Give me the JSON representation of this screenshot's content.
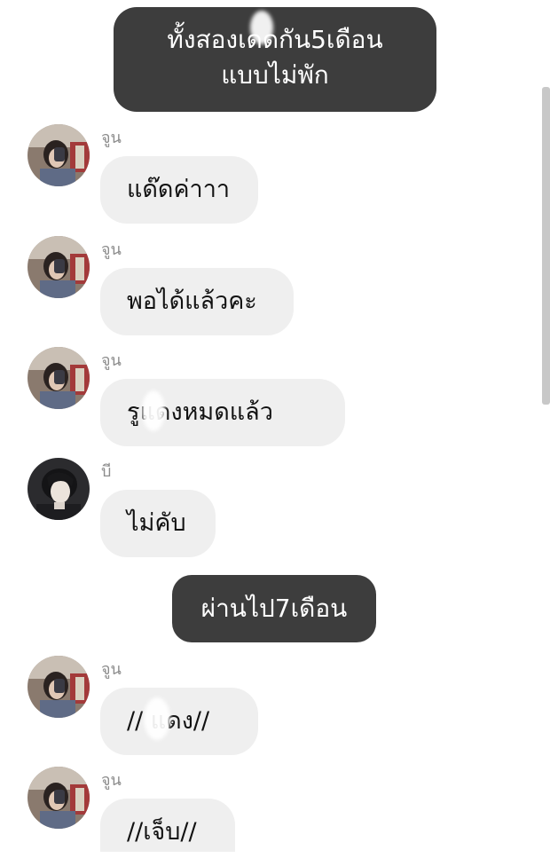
{
  "narrations": [
    {
      "lines": [
        "ทั้งสองเดดกัน5เดือน",
        "แบบไม่พัก"
      ]
    },
    {
      "lines": [
        "ผ่านไป7เดือน"
      ]
    }
  ],
  "messages": [
    {
      "sender": "จูน",
      "text": "แด๊ดค่าาา",
      "avatar": "selfie-photo"
    },
    {
      "sender": "จูน",
      "text": "พอได้แล้วคะ",
      "avatar": "selfie-photo"
    },
    {
      "sender": "จูน",
      "text": "รูแดงหมดแล้ว",
      "avatar": "selfie-photo"
    },
    {
      "sender": "บี",
      "text": "ไม่คับ",
      "avatar": "portrait-photo"
    },
    {
      "sender": "จูน",
      "text": "// แดง//",
      "avatar": "selfie-photo"
    },
    {
      "sender": "จูน",
      "text": "//เจ็บ//",
      "avatar": "selfie-photo"
    }
  ],
  "colors": {
    "narration_bg": "#3d3d3d",
    "bubble_bg": "#efefef",
    "sender_text": "#8c8c8c"
  }
}
